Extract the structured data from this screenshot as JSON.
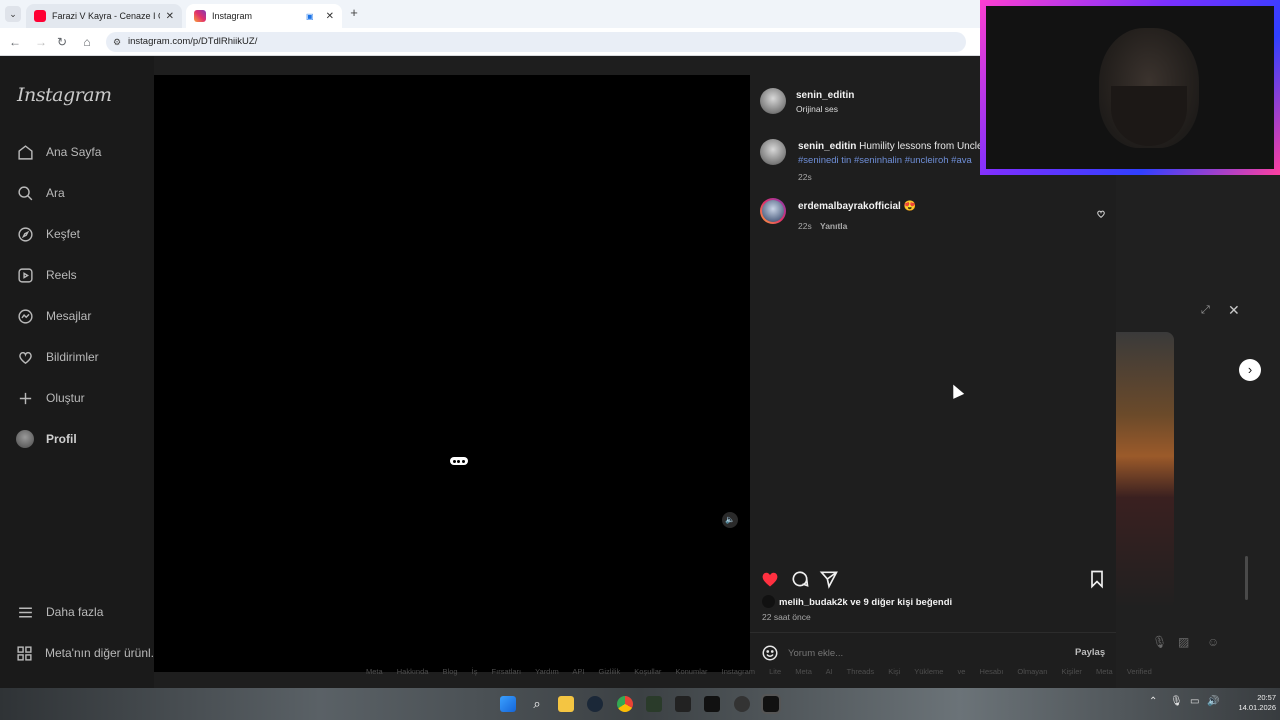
{
  "browser": {
    "tabs": [
      {
        "title": "Farazi V Kayra - Cenaze I Ölülerle Dans",
        "active": false,
        "favicon_color": "#ff0033"
      },
      {
        "title": "Instagram",
        "active": true,
        "favicon_color": "#e1306c"
      }
    ],
    "new_tab_symbol": "+",
    "url": "instagram.com/p/DTdlRhiikUZ/"
  },
  "sidebar": {
    "logo": "Instagram",
    "items": [
      {
        "label": "Ana Sayfa",
        "icon": "home-icon"
      },
      {
        "label": "Ara",
        "icon": "search-icon"
      },
      {
        "label": "Keşfet",
        "icon": "compass-icon"
      },
      {
        "label": "Reels",
        "icon": "reels-icon"
      },
      {
        "label": "Mesajlar",
        "icon": "messenger-icon"
      },
      {
        "label": "Bildirimler",
        "icon": "heart-icon"
      },
      {
        "label": "Oluştur",
        "icon": "plus-icon"
      },
      {
        "label": "Profil",
        "icon": "avatar"
      }
    ],
    "more": "Daha fazla",
    "meta": "Meta'nın diğer ürünl..."
  },
  "post": {
    "author": "senin_editin",
    "audio": "Orijinal ses",
    "caption_user": "senin_editin",
    "caption_text": "Humility lessons from Uncle",
    "hashtags": "#seninedi tin #seninhalin #uncleiroh #ava",
    "caption_time": "22s",
    "comments": [
      {
        "user": "erdemalbayrakofficial",
        "emoji": "😍",
        "time": "22s",
        "reply": "Yanıtla"
      }
    ],
    "likes_text": "melih_budak2k ve 9 diğer kişi beğendi",
    "posted": "22 saat önce",
    "comment_placeholder": "Yorum ekle...",
    "share_label": "Paylaş"
  },
  "footer_links": "Meta Hakkında Blog İş Fırsatları Yardım API Gizlilik Koşullar Konumlar Instagram Lite Meta AI Threads Kişi Yükleme ve Hesabı Olmayan Kişiler Meta Verified",
  "taskbar": {
    "time": "20:57",
    "date": "14.01.2026"
  },
  "colors": {
    "like_red": "#ff3040",
    "link_blue": "#6f8fd8",
    "panel_bg": "#1e1e1e"
  }
}
